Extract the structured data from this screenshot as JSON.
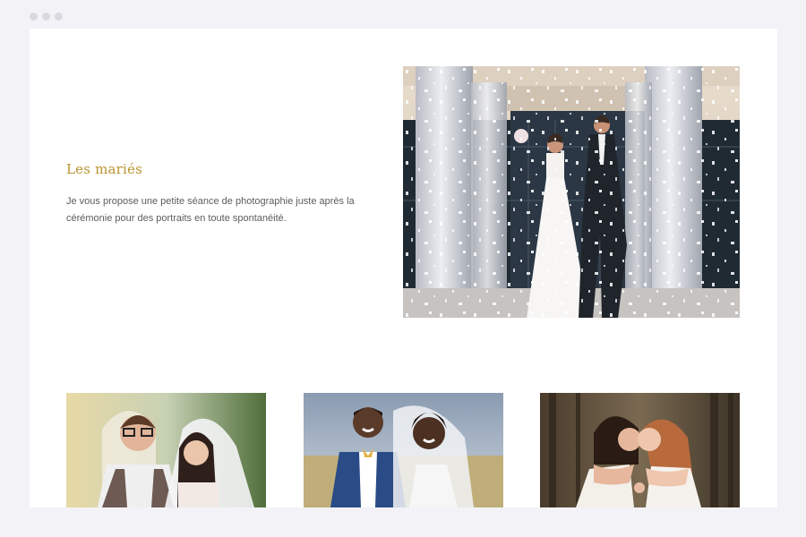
{
  "section": {
    "title": "Les mariés",
    "description": "Je vous propose une petite séance de photographie juste après la cérémonie pour des portraits en toute spontanéité."
  },
  "colors": {
    "accent": "#b8932f",
    "page_bg": "#ffffff",
    "frame_bg": "#f2f2f7",
    "text": "#5c5c5c"
  }
}
